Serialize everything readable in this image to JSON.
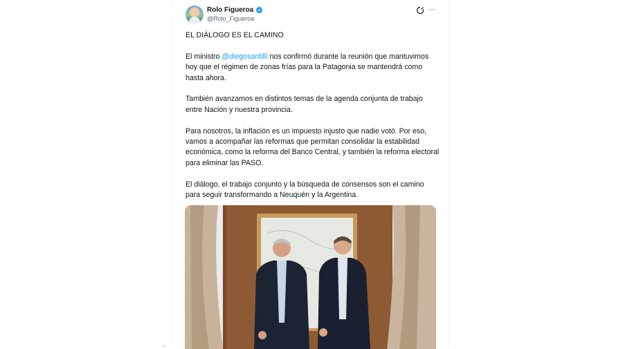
{
  "author": {
    "name": "Rolo Figueroa",
    "handle": "@Rolo_Figueroa",
    "verified_color": "#1d9bf0"
  },
  "tweet": {
    "title": "EL DIÁLOGO ES EL CAMINO",
    "p1_before": "El ministro ",
    "p1_mention": "@diegosantilli",
    "p1_after": " nos confirmó durante la reunión que mantuvimos hoy que el régimen de zonas frías para la Patagonia se mantendrá como hasta ahora.",
    "p2": "También avanzamos en distintos temas de la agenda conjunta de trabajo entre Nación y nuestra provincia.",
    "p3": "Para nosotros, la inflación es un impuesto injusto que nadie votó. Por eso, vamos a acompañar las reformas que permitan consolidar la estabilidad económica, como la reforma del Banco Central, y también la reforma electoral para eliminar las PASO.",
    "p4": "El diálogo, el trabajo conjunto y la búsqueda de consensos son el camino para seguir transformando a Neuquén y la Argentina."
  },
  "icons": {
    "grok": "grok-icon",
    "more": "more-icon",
    "verified": "verified-badge-icon"
  },
  "media": {
    "type": "photo",
    "description_icon": "photo-two-men-in-office"
  },
  "colors": {
    "link": "#1d9bf0",
    "text": "#0f1419",
    "secondary": "#536471"
  }
}
